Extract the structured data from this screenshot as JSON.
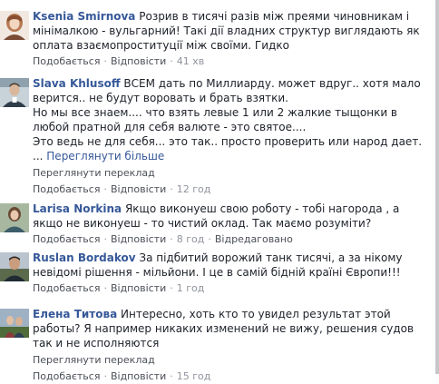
{
  "comments": [
    {
      "author": "Ksenia Smirnova",
      "text": "Розрив в тисячі разів між преями чиновникам і мінімалкою - вульгарний! Такі дії владних структур виглядають як оплата взаємопроституції між своїми. Гидко",
      "like": "Подобається",
      "reply": "Відповісти",
      "time": "41 хв"
    },
    {
      "author": "Slava Khlusoff",
      "text_lines": [
        "ВСЕМ дать по Миллиарду. может вдруг.. хотя мало верится.. не будут воровать и брать взятки.",
        "Но мы все знаем.... что взять левые 1 или 2 жалкие тыщонки в любой пратной для себя валюте - это святое....",
        "Это ведь не для себя... это так.. просто проверить или народ дает."
      ],
      "dots": "...",
      "see_more": "Переглянути більше",
      "translate": "Переглянути переклад",
      "like": "Подобається",
      "reply": "Відповісти",
      "time": "12 год"
    },
    {
      "author": "Larisa Norkina",
      "text": "Якщо виконуеш свою роботу - тобі нагорода , а якщо не виконуеш - то чистий оклад. Так маємо розуміти?",
      "like": "Подобається",
      "reply": "Відповісти",
      "time": "8 год",
      "edited": "Відредаговано"
    },
    {
      "author": "Ruslan Bordakov",
      "text": "За підбитий ворожий танк тисячі, а за нікому невідомі рішення - мільйони. І це в самій бідній країні Європи!!!",
      "like": "Подобається",
      "reply": "Відповісти",
      "time": "1 год"
    },
    {
      "author": "Елена Титова",
      "text": "Интересно, хоть кто то увидел результат этой работы? Я например никаких изменений не вижу, решения судов так и не исполняются",
      "translate": "Переглянути переклад",
      "like": "Подобається",
      "reply": "Відповісти",
      "time": "15 год"
    }
  ],
  "colors": {
    "author": "#365899",
    "text": "#1d2129",
    "meta": "#90949c",
    "action": "#4b4f56"
  }
}
